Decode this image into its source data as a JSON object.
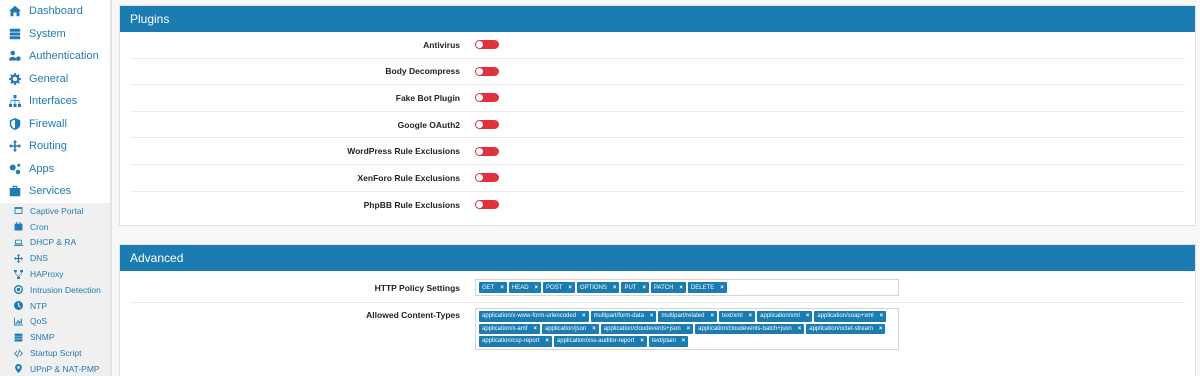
{
  "sidebar": {
    "main": [
      {
        "label": "Dashboard",
        "icon": "home-icon"
      },
      {
        "label": "System",
        "icon": "server-icon"
      },
      {
        "label": "Authentication",
        "icon": "users-cog-icon"
      },
      {
        "label": "General",
        "icon": "gear-icon"
      },
      {
        "label": "Interfaces",
        "icon": "network-icon"
      },
      {
        "label": "Firewall",
        "icon": "shield-icon"
      },
      {
        "label": "Routing",
        "icon": "arrows-icon"
      },
      {
        "label": "Apps",
        "icon": "cogs-icon"
      },
      {
        "label": "Services",
        "icon": "briefcase-icon"
      }
    ],
    "services": [
      {
        "label": "Captive Portal",
        "icon": "window-icon"
      },
      {
        "label": "Cron",
        "icon": "calendar-icon"
      },
      {
        "label": "DHCP & RA",
        "icon": "laptop-icon"
      },
      {
        "label": "DNS",
        "icon": "arrows-icon"
      },
      {
        "label": "HAProxy",
        "icon": "sitemap-icon"
      },
      {
        "label": "Intrusion Detection",
        "icon": "bullseye-icon"
      },
      {
        "label": "NTP",
        "icon": "clock-icon"
      },
      {
        "label": "QoS",
        "icon": "chart-icon"
      },
      {
        "label": "SNMP",
        "icon": "server-icon"
      },
      {
        "label": "Startup Script",
        "icon": "code-icon"
      },
      {
        "label": "UPnP & NAT-PMP",
        "icon": "map-marker-icon"
      }
    ]
  },
  "plugins": {
    "title": "Plugins",
    "items": [
      {
        "label": "Antivirus",
        "enabled": false
      },
      {
        "label": "Body Decompress",
        "enabled": false
      },
      {
        "label": "Fake Bot Plugin",
        "enabled": false
      },
      {
        "label": "Google OAuth2",
        "enabled": false
      },
      {
        "label": "WordPress Rule Exclusions",
        "enabled": false
      },
      {
        "label": "XenForo Rule Exclusions",
        "enabled": false
      },
      {
        "label": "PhpBB Rule Exclusions",
        "enabled": false
      }
    ]
  },
  "advanced": {
    "title": "Advanced",
    "http_policy": {
      "label": "HTTP Policy Settings",
      "tags": [
        "GET",
        "HEAD",
        "POST",
        "OPTIONS",
        "PUT",
        "PATCH",
        "DELETE"
      ]
    },
    "content_types": {
      "label": "Allowed Content-Types",
      "tags": [
        "application/x-www-form-urlencoded",
        "multipart/form-data",
        "multipart/related",
        "text/xml",
        "application/xml",
        "application/soap+xml",
        "application/x-amf",
        "application/json",
        "application/cloudevents+json",
        "application/cloudevents-batch+json",
        "application/octet-stream",
        "application/csp-report",
        "application/xss-auditor-report",
        "text/plain"
      ]
    },
    "remove_glyph": "×"
  },
  "colors": {
    "accent": "#1b7cb2",
    "toggle_off": "#e0313f",
    "nav_text": "#1f7ab5"
  }
}
